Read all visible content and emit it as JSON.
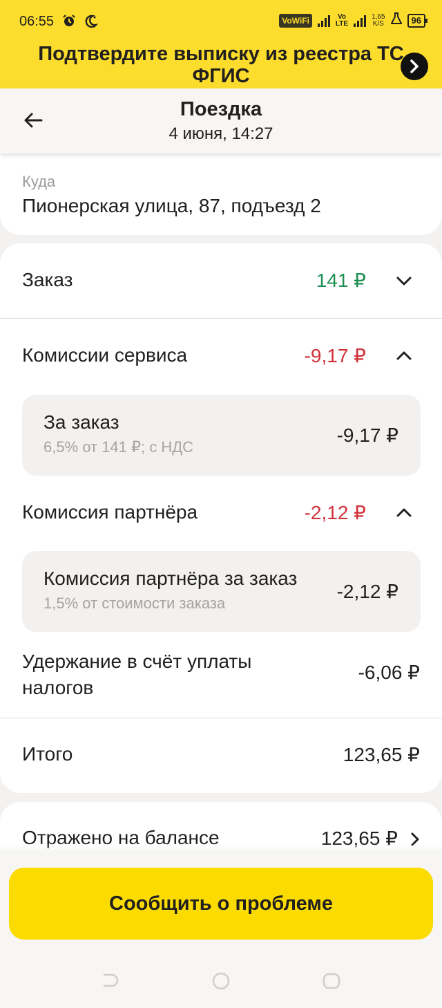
{
  "status_bar": {
    "time": "06:55",
    "wifi_label": "VoWiFi",
    "volte_top": "Vo",
    "volte_bottom": "LTE",
    "speed_top": "1,65",
    "speed_bottom": "K/S",
    "battery": "96"
  },
  "banner": {
    "text": "Подтвердите выписку из реестра ТС ФГИС",
    "background": "#fcdc2c"
  },
  "header": {
    "title": "Поездка",
    "subtitle": "4 июня, 14:27"
  },
  "destination": {
    "label": "Куда",
    "value": "Пионерская улица, 87, подъезд 2"
  },
  "finance": {
    "order": {
      "label": "Заказ",
      "value": "141 ₽",
      "expanded": false
    },
    "service_fees": {
      "label": "Комиссии сервиса",
      "value": "-9,17 ₽",
      "expanded": true,
      "item": {
        "title": "За заказ",
        "caption": "6,5% от 141 ₽; с НДС",
        "value": "-9,17 ₽"
      }
    },
    "partner_fee": {
      "label": "Комиссия партнёра",
      "value": "-2,12 ₽",
      "expanded": true,
      "item": {
        "title": "Комиссия партнёра за заказ",
        "caption": "1,5% от стоимости заказа",
        "value": "-2,12 ₽"
      }
    },
    "tax_hold": {
      "label_line1": "Удержание в счёт уплаты",
      "label_line2": "налогов",
      "value": "-6,06 ₽"
    },
    "total": {
      "label": "Итого",
      "value": "123,65 ₽"
    }
  },
  "balance": {
    "label": "Отражено на балансе",
    "value": "123,65 ₽"
  },
  "report_button": {
    "label": "Сообщить о проблеме"
  },
  "colors": {
    "accent": "#fcdc00",
    "positive": "#1f8f52",
    "negative": "#d0323a"
  }
}
